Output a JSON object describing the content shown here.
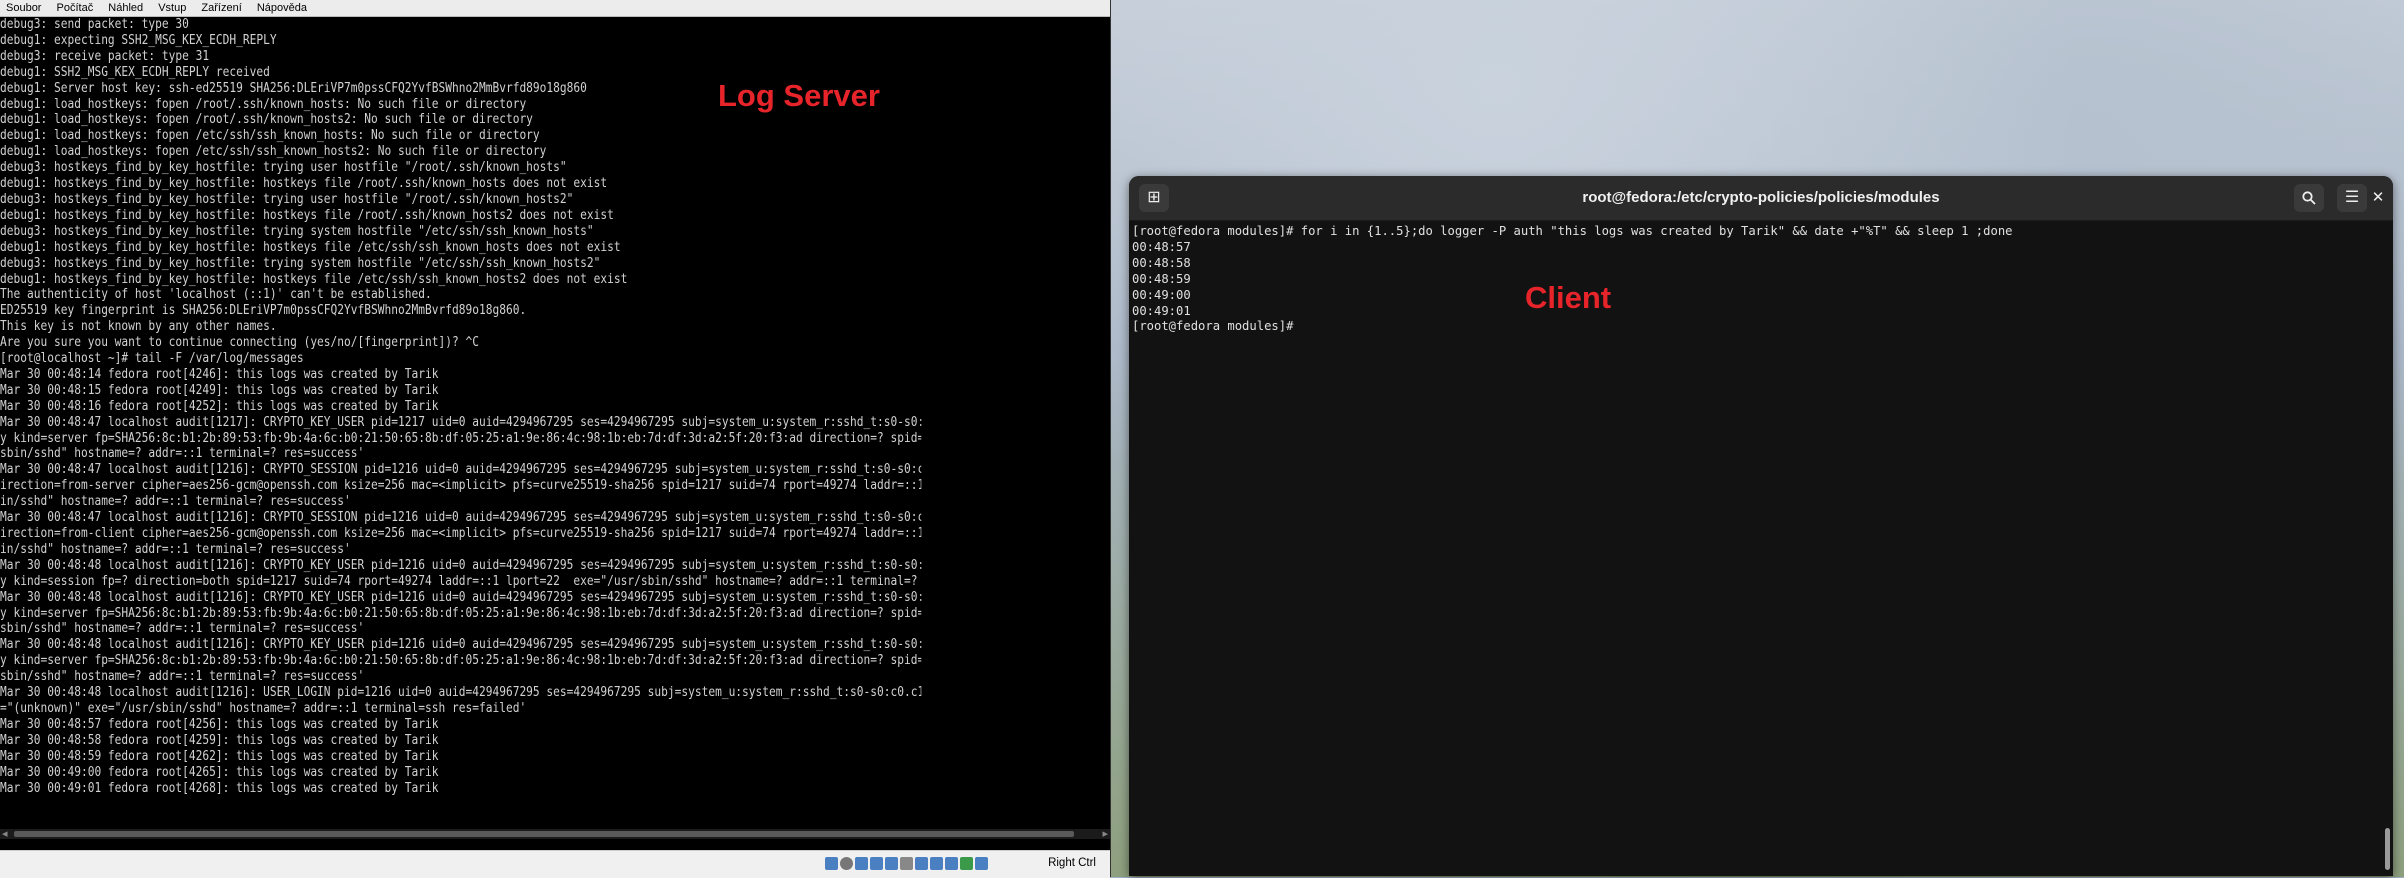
{
  "vm": {
    "menu": [
      "Soubor",
      "Počítač",
      "Náhled",
      "Vstup",
      "Zařízení",
      "Nápověda"
    ],
    "console_lines": [
      "debug3: send packet: type 30",
      "debug1: expecting SSH2_MSG_KEX_ECDH_REPLY",
      "debug3: receive packet: type 31",
      "debug1: SSH2_MSG_KEX_ECDH_REPLY received",
      "debug1: Server host key: ssh-ed25519 SHA256:DLEriVP7m0pssCFQ2YvfBSWhno2MmBvrfd89o18g860",
      "debug1: load_hostkeys: fopen /root/.ssh/known_hosts: No such file or directory",
      "debug1: load_hostkeys: fopen /root/.ssh/known_hosts2: No such file or directory",
      "debug1: load_hostkeys: fopen /etc/ssh/ssh_known_hosts: No such file or directory",
      "debug1: load_hostkeys: fopen /etc/ssh/ssh_known_hosts2: No such file or directory",
      "debug3: hostkeys_find_by_key_hostfile: trying user hostfile \"/root/.ssh/known_hosts\"",
      "debug1: hostkeys_find_by_key_hostfile: hostkeys file /root/.ssh/known_hosts does not exist",
      "debug3: hostkeys_find_by_key_hostfile: trying user hostfile \"/root/.ssh/known_hosts2\"",
      "debug1: hostkeys_find_by_key_hostfile: hostkeys file /root/.ssh/known_hosts2 does not exist",
      "debug3: hostkeys_find_by_key_hostfile: trying system hostfile \"/etc/ssh/ssh_known_hosts\"",
      "debug1: hostkeys_find_by_key_hostfile: hostkeys file /etc/ssh/ssh_known_hosts does not exist",
      "debug3: hostkeys_find_by_key_hostfile: trying system hostfile \"/etc/ssh/ssh_known_hosts2\"",
      "debug1: hostkeys_find_by_key_hostfile: hostkeys file /etc/ssh/ssh_known_hosts2 does not exist",
      "The authenticity of host 'localhost (::1)' can't be established.",
      "ED25519 key fingerprint is SHA256:DLEriVP7m0pssCFQ2YvfBSWhno2MmBvrfd89o18g860.",
      "This key is not known by any other names.",
      "Are you sure you want to continue connecting (yes/no/[fingerprint])? ^C",
      "[root@localhost ~]# tail -F /var/log/messages",
      "Mar 30 00:48:14 fedora root[4246]: this logs was created by Tarik",
      "Mar 30 00:48:15 fedora root[4249]: this logs was created by Tarik",
      "Mar 30 00:48:16 fedora root[4252]: this logs was created by Tarik",
      "Mar 30 00:48:47 localhost audit[1217]: CRYPTO_KEY_USER pid=1217 uid=0 auid=4294967295 ses=4294967295 subj=system_u:system_r:sshd_t:s0-s0:c0",
      "y kind=server fp=SHA256:8c:b1:2b:89:53:fb:9b:4a:6c:b0:21:50:65:8b:df:05:25:a1:9e:86:4c:98:1b:eb:7d:df:3d:a2:5f:20:f3:ad direction=? spid=12",
      "sbin/sshd\" hostname=? addr=::1 terminal=? res=success'",
      "Mar 30 00:48:47 localhost audit[1216]: CRYPTO_SESSION pid=1216 uid=0 auid=4294967295 ses=4294967295 subj=system_u:system_r:sshd_t:s0-s0:c0.",
      "irection=from-server cipher=aes256-gcm@openssh.com ksize=256 mac=<implicit> pfs=curve25519-sha256 spid=1217 suid=74 rport=49274 laddr=::1 l",
      "in/sshd\" hostname=? addr=::1 terminal=? res=success'",
      "Mar 30 00:48:47 localhost audit[1216]: CRYPTO_SESSION pid=1216 uid=0 auid=4294967295 ses=4294967295 subj=system_u:system_r:sshd_t:s0-s0:c0.",
      "irection=from-client cipher=aes256-gcm@openssh.com ksize=256 mac=<implicit> pfs=curve25519-sha256 spid=1217 suid=74 rport=49274 laddr=::1 l",
      "in/sshd\" hostname=? addr=::1 terminal=? res=success'",
      "Mar 30 00:48:48 localhost audit[1216]: CRYPTO_KEY_USER pid=1216 uid=0 auid=4294967295 ses=4294967295 subj=system_u:system_r:sshd_t:s0-s0:c0",
      "y kind=session fp=? direction=both spid=1217 suid=74 rport=49274 laddr=::1 lport=22  exe=\"/usr/sbin/sshd\" hostname=? addr=::1 terminal=? re",
      "Mar 30 00:48:48 localhost audit[1216]: CRYPTO_KEY_USER pid=1216 uid=0 auid=4294967295 ses=4294967295 subj=system_u:system_r:sshd_t:s0-s0:c0",
      "y kind=server fp=SHA256:8c:b1:2b:89:53:fb:9b:4a:6c:b0:21:50:65:8b:df:05:25:a1:9e:86:4c:98:1b:eb:7d:df:3d:a2:5f:20:f3:ad direction=? spid=12",
      "sbin/sshd\" hostname=? addr=::1 terminal=? res=success'",
      "Mar 30 00:48:48 localhost audit[1216]: CRYPTO_KEY_USER pid=1216 uid=0 auid=4294967295 ses=4294967295 subj=system_u:system_r:sshd_t:s0-s0:c0",
      "y kind=server fp=SHA256:8c:b1:2b:89:53:fb:9b:4a:6c:b0:21:50:65:8b:df:05:25:a1:9e:86:4c:98:1b:eb:7d:df:3d:a2:5f:20:f3:ad direction=? spid=12",
      "sbin/sshd\" hostname=? addr=::1 terminal=? res=success'",
      "Mar 30 00:48:48 localhost audit[1216]: USER_LOGIN pid=1216 uid=0 auid=4294967295 ses=4294967295 subj=system_u:system_r:sshd_t:s0-s0:c0.c102",
      "=\"(unknown)\" exe=\"/usr/sbin/sshd\" hostname=? addr=::1 terminal=ssh res=failed'",
      "Mar 30 00:48:57 fedora root[4256]: this logs was created by Tarik",
      "Mar 30 00:48:58 fedora root[4259]: this logs was created by Tarik",
      "Mar 30 00:48:59 fedora root[4262]: this logs was created by Tarik",
      "Mar 30 00:49:00 fedora root[4265]: this logs was created by Tarik",
      "Mar 30 00:49:01 fedora root[4268]: this logs was created by Tarik"
    ],
    "overlay_label": "Log Server",
    "host_key_label": "Right Ctrl"
  },
  "terminal": {
    "title": "root@fedora:/etc/crypto-policies/policies/modules",
    "lines": [
      "[root@fedora modules]# for i in {1..5};do logger -P auth \"this logs was created by Tarik\" && date +\"%T\" && sleep 1 ;done",
      "00:48:57",
      "00:48:58",
      "00:48:59",
      "00:49:00",
      "00:49:01",
      "[root@fedora modules]# "
    ],
    "overlay_label": "Client"
  },
  "colors": {
    "label_red": "#e8242b",
    "console_text": "#d2d2d2",
    "terminal_bg": "#121212"
  }
}
